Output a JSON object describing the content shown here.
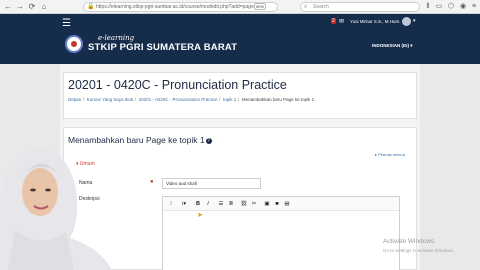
{
  "browser": {
    "url": "https://elearning.stkip-pgri-sumbar.ac.id/course/modedit.php?add=page",
    "zoom": "90%",
    "search_placeholder": "Search"
  },
  "navbar": {
    "notification_count": "2",
    "user_name": "Yusi Mirnar S.S., M.Hum.",
    "logo_script": "e-learning",
    "logo_text": "STKIP PGRI SUMATERA BARAT",
    "language": "INDONESIAN (ID) ▾"
  },
  "header": {
    "title": "20201 - 0420C - Pronunciation Practice",
    "breadcrumb": [
      "Depan",
      "Kursus Yang Saya Ikuti",
      "20201 - 0420C - Pronunciation Practice",
      "topik 1",
      "Menambahkan baru Page ke topik 1"
    ]
  },
  "form": {
    "heading": "Menambahkan baru Page ke topik 1",
    "expand_all": "▸ Perluas semua",
    "section_umum": "▾ Umum",
    "nama_label": "Nama",
    "nama_value": "Video aud shall",
    "deskripsi_label": "Deskripsi"
  },
  "watermark": {
    "title": "Activate Windows",
    "subtitle": "Go to Settings to activate Windows."
  }
}
